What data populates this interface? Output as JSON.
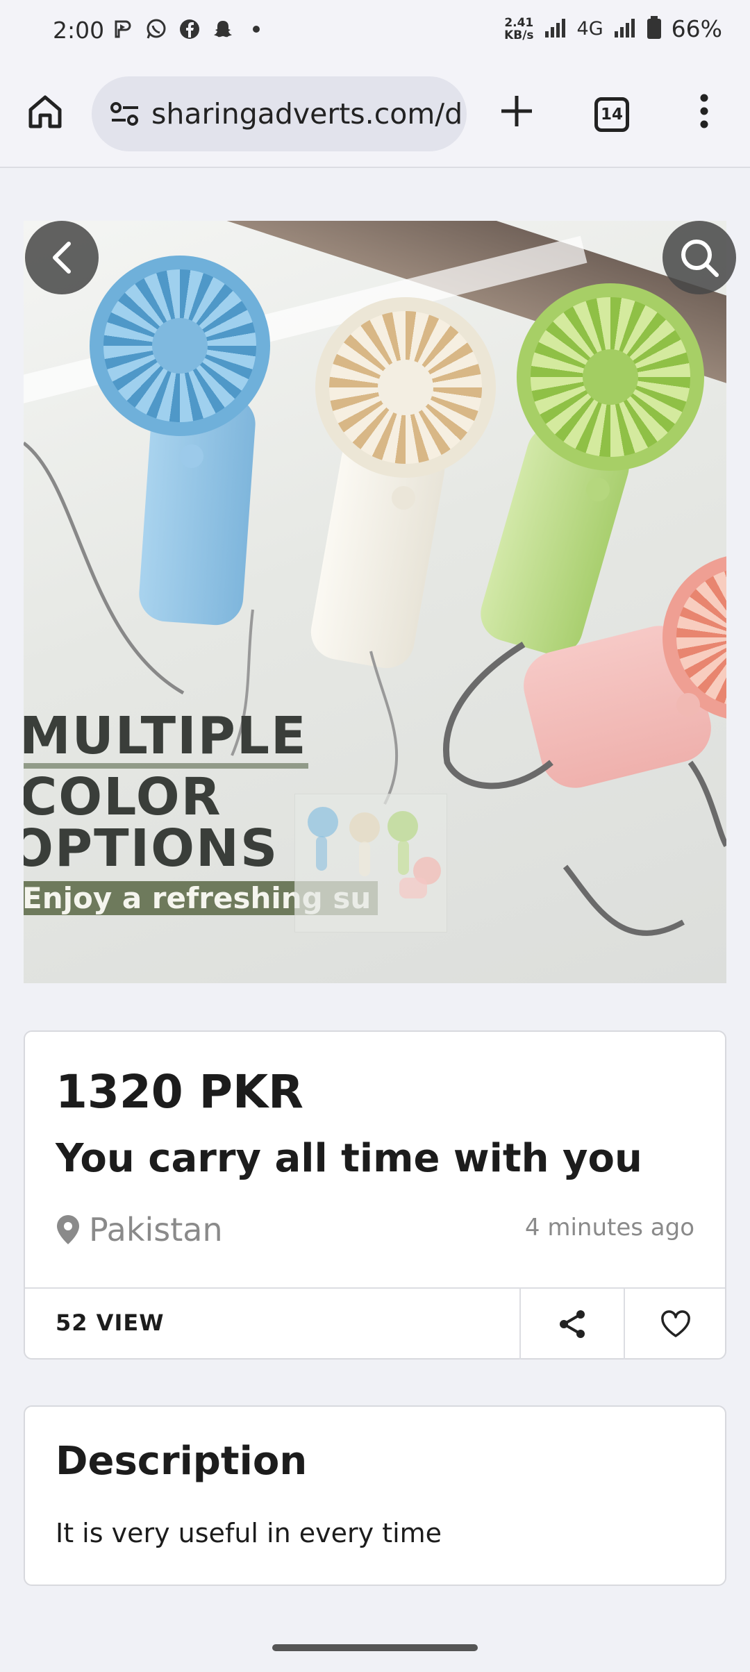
{
  "status_bar": {
    "time": "2:00",
    "speed": "2.41",
    "speed_unit": "KB/s",
    "network": "4G",
    "battery": "66%"
  },
  "browser": {
    "url": "sharingadverts.com/d",
    "tab_count": "14"
  },
  "hero": {
    "overlay_line1": "MULTIPLE",
    "overlay_line2": "COLOR",
    "overlay_line3": "OPTIONS",
    "overlay_sub": "Enjoy a refreshing su",
    "fan_colors": [
      "#8cc0e0",
      "#f2efe6",
      "#b9d98a",
      "#f3b9b4"
    ]
  },
  "listing": {
    "price": "1320 PKR",
    "title": "You carry all time with you",
    "location": "Pakistan",
    "posted": "4 minutes ago",
    "views": "52 VIEW"
  },
  "description": {
    "heading": "Description",
    "body": "It is very useful in every time"
  }
}
